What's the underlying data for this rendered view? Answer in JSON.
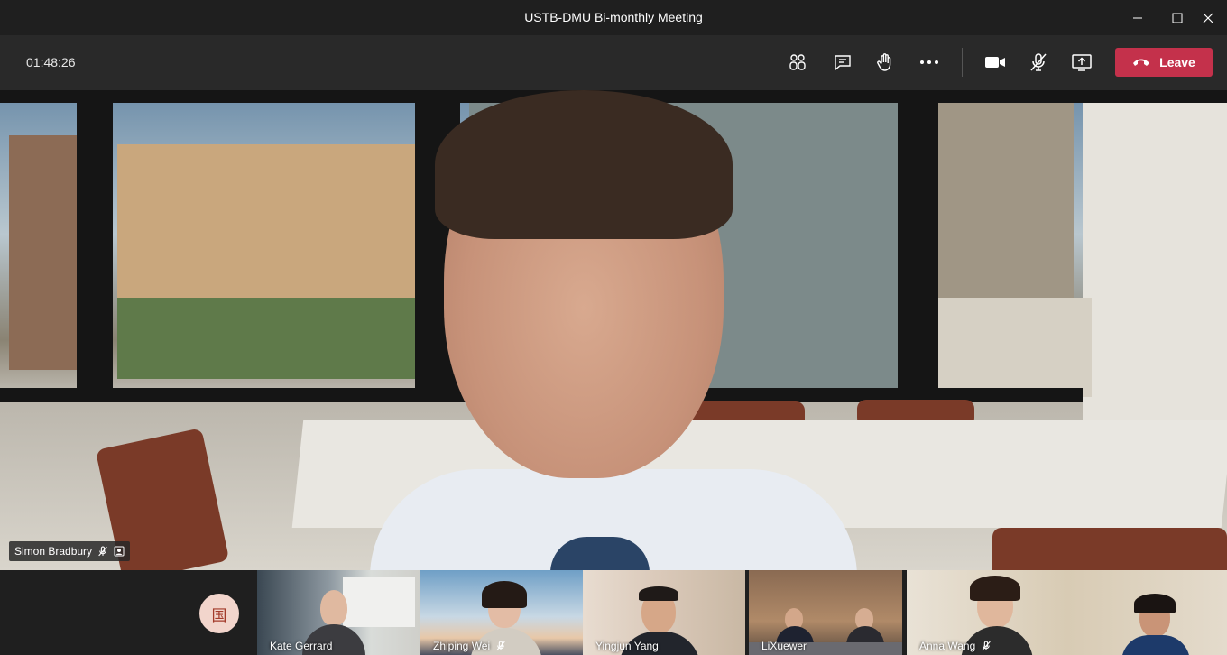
{
  "window": {
    "title": "USTB-DMU Bi-monthly Meeting",
    "minimize_icon": "minimize-icon",
    "maximize_icon": "maximize-icon",
    "close_icon": "close-icon"
  },
  "toolbar": {
    "timer": "01:48:26",
    "icons": [
      "participants-icon",
      "chat-icon",
      "raise-hand-icon",
      "more-actions-icon",
      "camera-icon",
      "mic-muted-icon",
      "share-screen-icon"
    ],
    "leave_label": "Leave",
    "leave_color": "#c4314b"
  },
  "main_video": {
    "participant_name": "Simon Bradbury",
    "status_icons": [
      "mic-muted-icon",
      "pinned-icon"
    ]
  },
  "participants_strip": {
    "avatar_initial": "国",
    "tiles": [
      {
        "name": "Kate Gerrard",
        "muted": false
      },
      {
        "name": "Zhiping Wei",
        "muted": true
      },
      {
        "name": "Yingjun Yang",
        "muted": false
      },
      {
        "name": "LiXuewer",
        "muted": false
      },
      {
        "name": "Anna Wang",
        "muted": true
      }
    ]
  }
}
